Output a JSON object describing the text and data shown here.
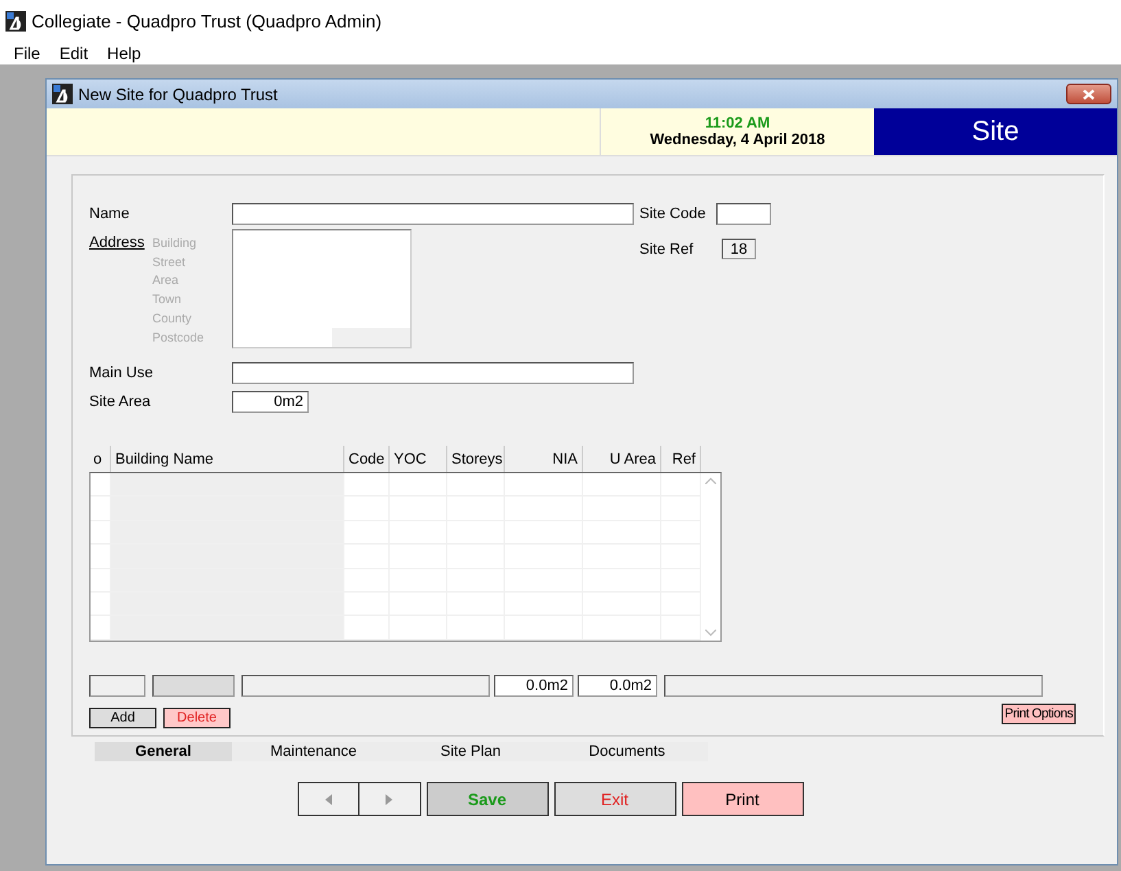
{
  "app": {
    "title": "Collegiate - Quadpro Trust (Quadpro Admin)",
    "menu": [
      "File",
      "Edit",
      "Help"
    ]
  },
  "window": {
    "title": "New Site for Quadpro Trust",
    "time": "11:02 AM",
    "date": "Wednesday, 4 April 2018",
    "section": "Site"
  },
  "form": {
    "name": {
      "label": "Name"
    },
    "site_code": {
      "label": "Site Code"
    },
    "site_ref": {
      "label": "Site Ref",
      "value": "18"
    },
    "address": {
      "label": "Address",
      "lines": [
        "Building",
        "Street",
        "Area",
        "Town",
        "County",
        "Postcode"
      ]
    },
    "main_use": {
      "label": "Main Use"
    },
    "site_area": {
      "label": "Site Area",
      "value": "0m2"
    }
  },
  "table": {
    "columns": [
      "o",
      "Building Name",
      "Code",
      "YOC",
      "Storeys",
      "NIA",
      "U Area",
      "Ref"
    ]
  },
  "totals": [
    {
      "kind": "blank"
    },
    {
      "kind": "shaded"
    },
    {
      "kind": "blank"
    },
    {
      "kind": "value",
      "value": "0.0m2"
    },
    {
      "kind": "value",
      "value": "0.0m2"
    },
    {
      "kind": "blank"
    }
  ],
  "row_buttons": [
    {
      "label": "Add",
      "kind": "plain"
    },
    {
      "label": "Delete",
      "kind": "danger"
    }
  ],
  "print_options": "Print Options",
  "tabs": [
    {
      "label": "General",
      "selected": true
    },
    {
      "label": "Maintenance",
      "selected": false
    },
    {
      "label": "Site Plan",
      "selected": false
    },
    {
      "label": "Documents",
      "selected": false
    }
  ],
  "actions": [
    {
      "label": "Save",
      "kind": "save"
    },
    {
      "label": "Exit",
      "kind": "exit"
    },
    {
      "label": "Print",
      "kind": "print"
    }
  ]
}
